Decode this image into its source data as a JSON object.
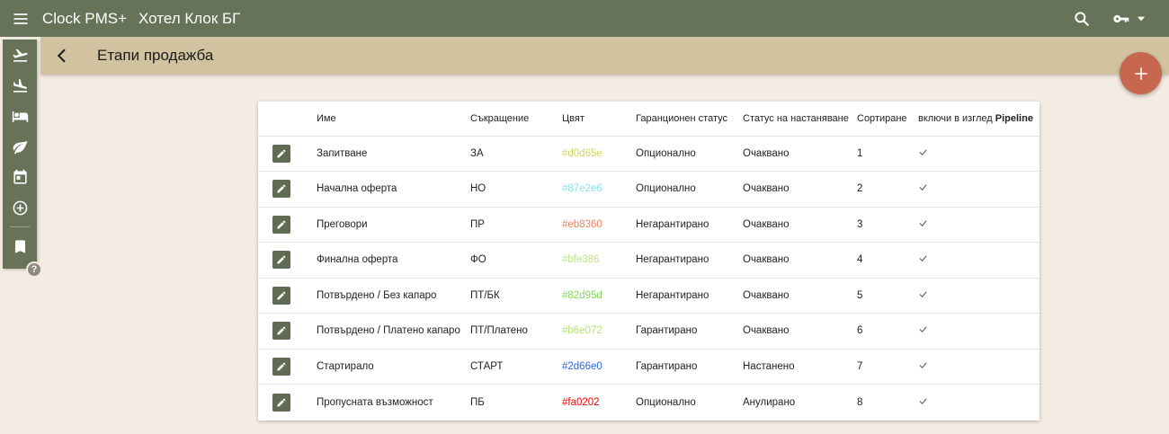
{
  "header": {
    "app_name": "Clock PMS+",
    "hotel_name": "Хотел Клок БГ"
  },
  "subheader": {
    "title": "Етапи продажба"
  },
  "rail": {
    "items": [
      "departure-icon",
      "arrival-icon",
      "bed-icon",
      "leaf-icon",
      "calendar-icon",
      "add-circle-icon",
      "book-icon"
    ]
  },
  "help": {
    "label": "?"
  },
  "table": {
    "headers": {
      "name": "Име",
      "abbr": "Съкращение",
      "color": "Цвят",
      "guarantee": "Гаранционен статус",
      "arrangement": "Статус на настаняване",
      "sort": "Сортиране",
      "pipeline_prefix": "включи в изглед ",
      "pipeline_bold": "Pipeline"
    },
    "rows": [
      {
        "name": "Запитване",
        "abbr": "ЗА",
        "color": "#d0d65e",
        "guarantee": "Опционално",
        "arrangement": "Очаквано",
        "sort": "1",
        "pipeline": "✓"
      },
      {
        "name": "Начална оферта",
        "abbr": "НО",
        "color": "#87e2e6",
        "guarantee": "Опционално",
        "arrangement": "Очаквано",
        "sort": "2",
        "pipeline": "✓"
      },
      {
        "name": "Преговори",
        "abbr": "ПР",
        "color": "#eb8360",
        "guarantee": "Негарантирано",
        "arrangement": "Очаквано",
        "sort": "3",
        "pipeline": "✓"
      },
      {
        "name": "Финална оферта",
        "abbr": "ФО",
        "color": "#bfe386",
        "guarantee": "Негарантирано",
        "arrangement": "Очаквано",
        "sort": "4",
        "pipeline": "✓"
      },
      {
        "name": "Потвърдено / Без капаро",
        "abbr": "ПТ/БК",
        "color": "#82d95d",
        "guarantee": "Негарантирано",
        "arrangement": "Очаквано",
        "sort": "5",
        "pipeline": "✓"
      },
      {
        "name": "Потвърдено / Платено капаро",
        "abbr": "ПТ/Платено",
        "color": "#b6e072",
        "guarantee": "Гарантирано",
        "arrangement": "Очаквано",
        "sort": "6",
        "pipeline": "✓"
      },
      {
        "name": "Стартирало",
        "abbr": "СТАРТ",
        "color": "#2d66e0",
        "guarantee": "Гарантирано",
        "arrangement": "Настанено",
        "sort": "7",
        "pipeline": "✓"
      },
      {
        "name": "Пропусната възможност",
        "abbr": "ПБ",
        "color": "#fa0202",
        "guarantee": "Опционално",
        "arrangement": "Анулирано",
        "sort": "8",
        "pipeline": "✓"
      }
    ]
  },
  "colors": {
    "topbar": "#667358",
    "subheader": "#d1c3a0",
    "background": "#f4ece3",
    "fab": "#c8674f",
    "edit_button": "#5f6b52"
  }
}
